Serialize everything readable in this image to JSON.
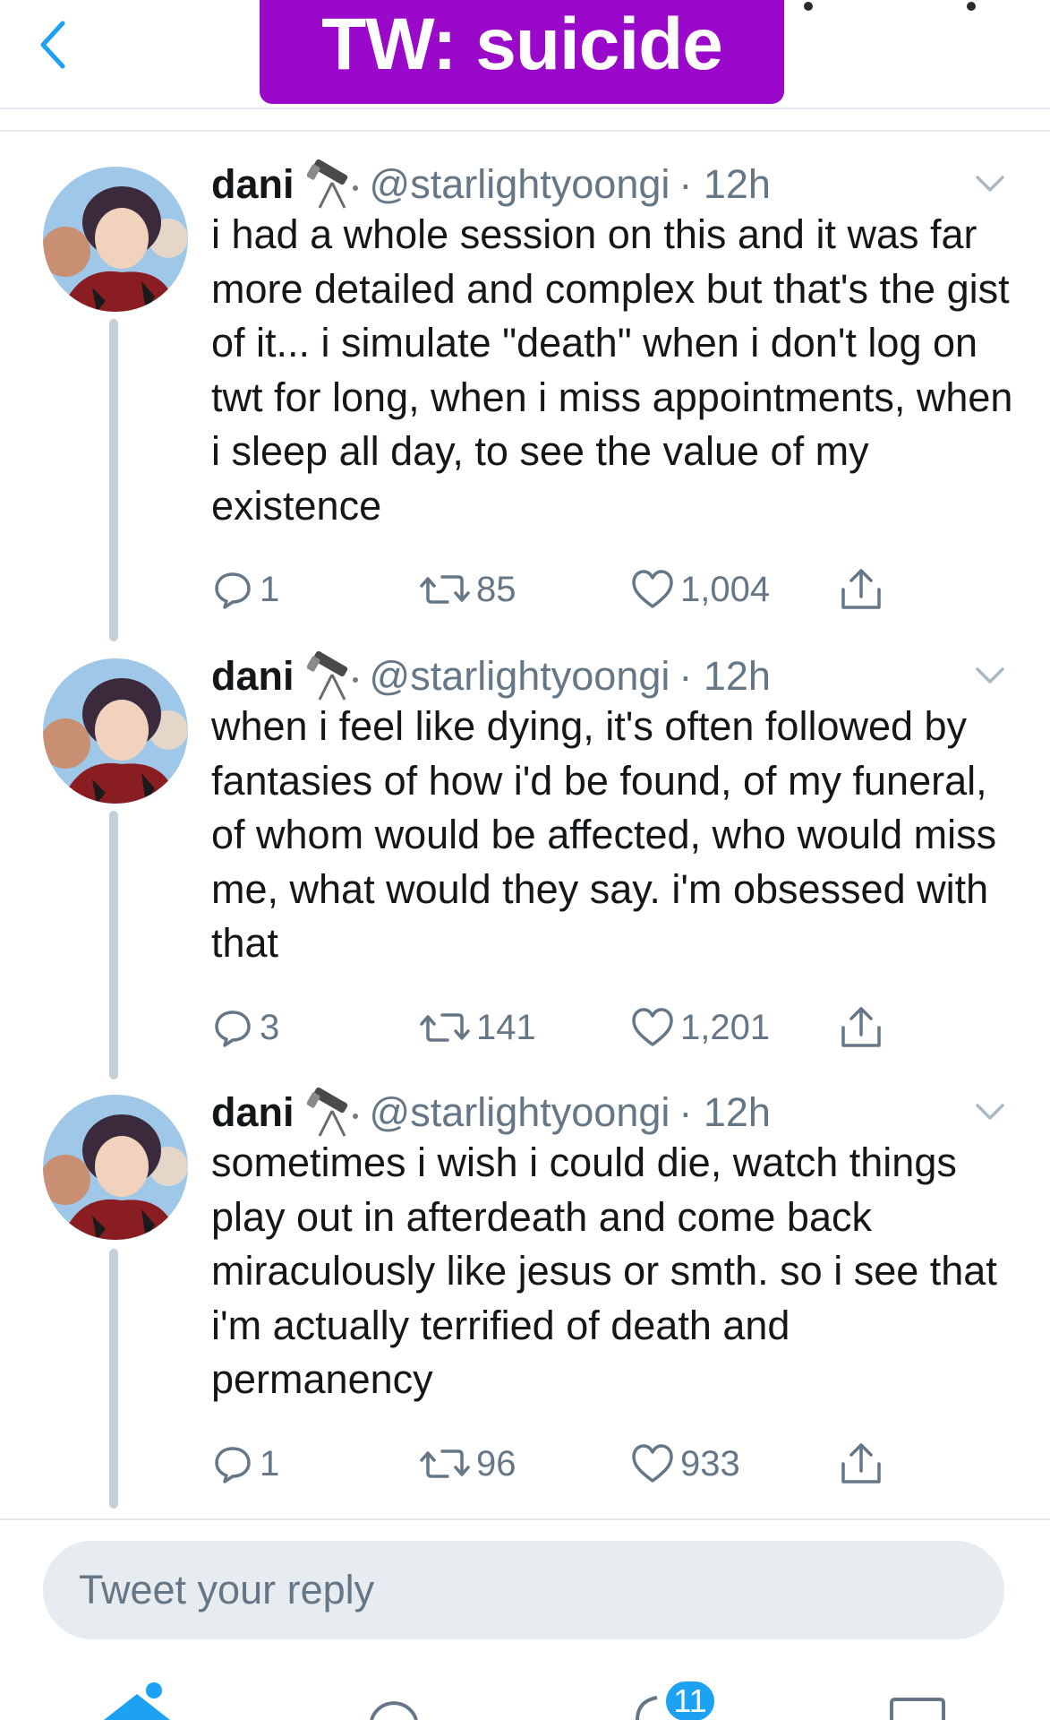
{
  "banner": {
    "text": "TW: suicide",
    "color": "#9a08c9"
  },
  "colors": {
    "accent": "#1da1f2",
    "thread_line": "#c4d0d8",
    "muted": "#657786"
  },
  "icons": {
    "back": "chevron-left-icon",
    "author_emoji": "telescope-icon",
    "reply": "speech-bubble-icon",
    "retweet": "retweet-icon",
    "like": "heart-icon",
    "share": "share-icon",
    "more": "chevron-down-icon"
  },
  "tweets": [
    {
      "name": "dani",
      "handle": "@starlightyoongi",
      "time": "· 12h",
      "text": "i had a whole session on this and it was far more detailed and complex but that's the gist of it... i simulate \"death\" when i don't log on twt for long, when i miss appointments, when i sleep all day, to see the value of my existence",
      "replies": "1",
      "retweets": "85",
      "likes": "1,004"
    },
    {
      "name": "dani",
      "handle": "@starlightyoongi",
      "time": "· 12h",
      "text": "when i feel like dying, it's often followed by fantasies of how i'd be found, of my funeral, of whom would be affected, who would miss me, what would they say. i'm obsessed with that",
      "replies": "3",
      "retweets": "141",
      "likes": "1,201"
    },
    {
      "name": "dani",
      "handle": "@starlightyoongi",
      "time": "· 12h",
      "text": "sometimes i wish i could die, watch things play out in afterdeath and come back miraculously like jesus or smth. so i see that i'm actually terrified of death and permanency",
      "replies": "1",
      "retweets": "96",
      "likes": "933"
    }
  ],
  "reply_box": {
    "placeholder": "Tweet your reply"
  },
  "tabbar": {
    "notifications_badge": "11"
  }
}
